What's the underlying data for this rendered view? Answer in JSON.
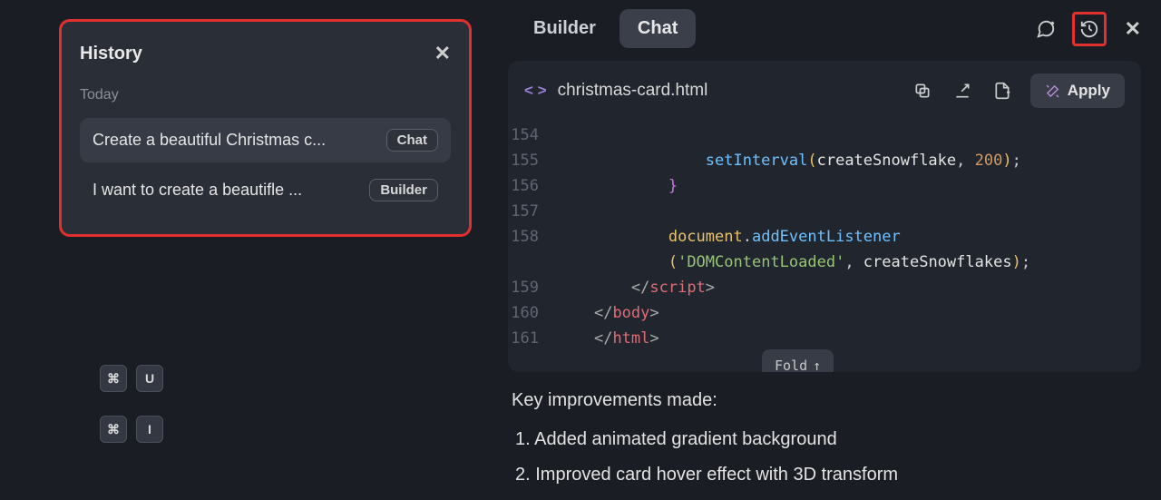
{
  "history": {
    "title": "History",
    "group_label": "Today",
    "items": [
      {
        "text": "Create a beautiful Christmas c...",
        "badge": "Chat",
        "active": true
      },
      {
        "text": "I want to create a beautifle ...",
        "badge": "Builder",
        "active": false
      }
    ]
  },
  "shortcuts": {
    "row1": [
      "⌘",
      "U"
    ],
    "row2": [
      "⌘",
      "I"
    ]
  },
  "tabs": {
    "builder": "Builder",
    "chat": "Chat",
    "active": "chat"
  },
  "code": {
    "filename": "christmas-card.html",
    "apply_label": "Apply",
    "fold_label": "Fold",
    "lines": [
      {
        "n": "154",
        "html": ""
      },
      {
        "n": "155",
        "html": "                <span class='c-fn'>setInterval</span><span class='c-paren'>(</span>createSnowflake<span class='c-kw'>,</span> <span class='c-num'>200</span><span class='c-paren'>)</span><span class='c-kw'>;</span>"
      },
      {
        "n": "156",
        "html": "            <span class='c-bparen'>}</span>"
      },
      {
        "n": "157",
        "html": ""
      },
      {
        "n": "158",
        "html": "            <span class='c-obj'>document</span><span class='c-kw'>.</span><span class='c-method'>addEventListener</span>"
      },
      {
        "n": "",
        "html": "            <span class='c-paren'>(</span><span class='c-str'>'DOMContentLoaded'</span><span class='c-kw'>,</span> createSnowflakes<span class='c-paren'>)</span><span class='c-kw'>;</span>"
      },
      {
        "n": "159",
        "html": "        <span class='c-ang'>&lt;/</span><span class='c-tag'>script</span><span class='c-ang'>&gt;</span>"
      },
      {
        "n": "160",
        "html": "    <span class='c-ang'>&lt;/</span><span class='c-tag'>body</span><span class='c-ang'>&gt;</span>"
      },
      {
        "n": "161",
        "html": "    <span class='c-ang'>&lt;/</span><span class='c-tag'>html</span><span class='c-ang'>&gt;</span>"
      }
    ]
  },
  "chat_response": {
    "heading": "Key improvements made:",
    "items": [
      "1. Added animated gradient background",
      "2. Improved card hover effect with 3D transform"
    ]
  }
}
